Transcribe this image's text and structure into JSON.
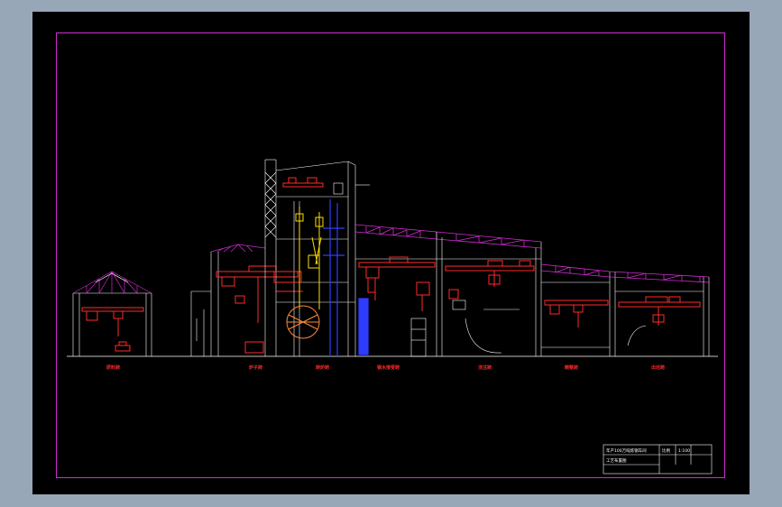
{
  "sheet": {
    "background": "#000000",
    "border_color": "#d32bd3",
    "app_background": "#98a7b8"
  },
  "colors": {
    "structure": "#ffffff",
    "roof": "#d32bd3",
    "equipment": "#ff2a2a",
    "equipment_alt": "#ff8a3a",
    "vessel": "#ffe000",
    "column": "#2f3cff"
  },
  "section_labels": [
    "原料跨",
    "炉子跨",
    "转炉跨",
    "钢水接受跨",
    "浇注跨",
    "精整跨",
    "出坯跨"
  ],
  "title_block": {
    "drawing_title": "年产100万吨炼钢车间",
    "drawing_no": "工艺布置图",
    "scale_label": "比例",
    "scale_value": "1:100"
  }
}
